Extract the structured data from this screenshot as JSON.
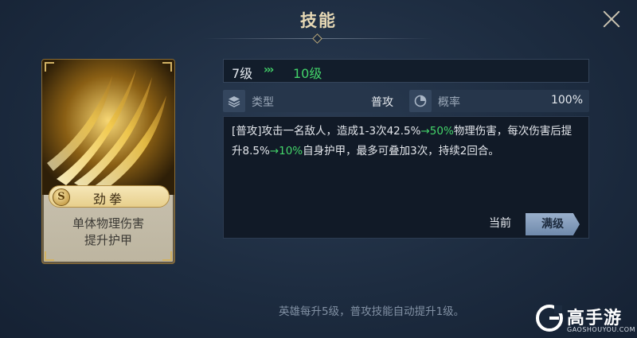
{
  "header": {
    "title": "技能"
  },
  "card": {
    "rank": "S",
    "skill_name": "劲拳",
    "desc_line1": "单体物理伤害",
    "desc_line2": "提升护甲"
  },
  "level": {
    "current": "7级",
    "arrows": "›››",
    "max": "10级"
  },
  "attributes": {
    "type_label": "类型",
    "type_value": "普攻",
    "chance_label": "概率",
    "chance_value": "100%"
  },
  "description": {
    "seg1": "[普攻]攻击一名敌人，造成1-3次42.5%",
    "seg2": "→50%",
    "seg3": "物理伤害，每次伤害后提升8.5%",
    "seg4": "→10%",
    "seg5": "自身护甲，最多可叠加3次，持续2回合。"
  },
  "buttons": {
    "current": "当前",
    "max": "满级"
  },
  "footer": {
    "note": "英雄每升5级，普攻技能自动提升1级。"
  },
  "watermark": {
    "brand": "高手游",
    "url": "GAOSHOUYOU.COM"
  },
  "colors": {
    "green": "#44d56a",
    "gold": "#e7cf8c",
    "bg": "#1d2c40"
  }
}
